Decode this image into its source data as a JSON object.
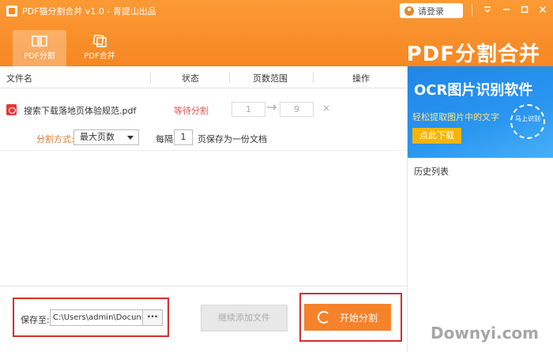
{
  "window": {
    "title": "PDF猫分割合并 v1.0 - 青提山出品",
    "login_label": "请登录",
    "brand": "PDF分割合并"
  },
  "tabs": [
    {
      "label": "PDF分割",
      "active": true,
      "icon": "split-icon"
    },
    {
      "label": "PDF合并",
      "active": false,
      "icon": "merge-icon"
    }
  ],
  "table": {
    "headers": [
      "文件名",
      "状态",
      "页数范围",
      "操作"
    ],
    "rows": [
      {
        "filename": "搜索下载落地页体验规范.pdf",
        "status": "等待分割",
        "range_from": "1",
        "range_to": "9",
        "delete_symbol": "×"
      }
    ]
  },
  "split": {
    "label": "分割方式:",
    "mode": "最大页数",
    "every_label": "每隔",
    "every_value": "1",
    "every_suffix": "页保存为一份文档"
  },
  "bottom": {
    "save_label": "保存至:",
    "save_path": "C:\\Users\\admin\\Docun",
    "browse_label": "···",
    "add_label": "继续添加文件",
    "start_label": "开始分割"
  },
  "ad": {
    "title": "OCR图片识别软件",
    "subtitle": "轻松提取图片中的文字",
    "button": "点此下载",
    "circle_text": "马上识别"
  },
  "history_label": "历史列表",
  "watermark": "Downyi.com",
  "colors": {
    "accent": "#f78722",
    "status": "#e0554a",
    "highlight_border": "#d32f2f",
    "ad_blue": "#1f86e8"
  }
}
